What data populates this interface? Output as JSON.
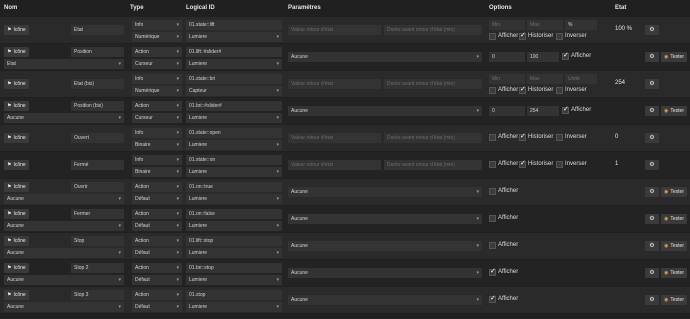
{
  "headers": {
    "nom": "Nom",
    "type": "Type",
    "logical_id": "Logical ID",
    "parametres": "Paramètres",
    "options": "Options",
    "etat": "Etat"
  },
  "labels": {
    "icone": "Icône",
    "tester": "Tester",
    "afficher": "Afficher",
    "historiser": "Historiser",
    "inverser": "Inverser",
    "valeur_retour_etat": "Valeur retour d'état",
    "duree_retour_etat": "Durée avant retour d'état (min)",
    "min": "Min",
    "max": "Max",
    "unite": "Unité",
    "percent": "%"
  },
  "rows": [
    {
      "name": "Etat",
      "type1": "Info",
      "type2": "Numérique",
      "lid": "01.state::lift",
      "lid2": "Lumiere",
      "params": "info",
      "unit": "%",
      "min_ph": "Min",
      "max_ph": "Max",
      "afficher": false,
      "historiser": true,
      "inverser": false,
      "etat": "100 %",
      "tester": false
    },
    {
      "name": "Position",
      "sub": "Etat",
      "type1": "Action",
      "type2": "Curseur",
      "lid": "01.lift::#slider#",
      "lid2": "Lumiere",
      "params": "select",
      "select_val": "Aucune",
      "min": "0",
      "max": "100",
      "afficher": true,
      "tester": true
    },
    {
      "name": "Etat (bis)",
      "type1": "Info",
      "type2": "Numérique",
      "lid": "01.state::bri",
      "lid2": "Capteur",
      "params": "info",
      "unit": "Unité",
      "min_ph": "Min",
      "max_ph": "Max",
      "afficher": false,
      "historiser": true,
      "inverser": false,
      "etat": "254",
      "tester": false
    },
    {
      "name": "Position (bis)",
      "sub": "Aucune",
      "type1": "Action",
      "type2": "Curseur",
      "lid": "01.bri::#slider#",
      "lid2": "Lumiere",
      "params": "select",
      "select_val": "Aucune",
      "min": "0",
      "max": "254",
      "afficher": true,
      "tester": true
    },
    {
      "name": "Ouvert",
      "type1": "Info",
      "type2": "Binaire",
      "lid": "01.state::open",
      "lid2": "Lumiere",
      "params": "info2",
      "afficher": false,
      "historiser": true,
      "inverser": false,
      "etat": "0",
      "tester": false
    },
    {
      "name": "Fermé",
      "type1": "Info",
      "type2": "Binaire",
      "lid": "01.state::on",
      "lid2": "Lumiere",
      "params": "info2",
      "afficher": false,
      "historiser": true,
      "inverser": false,
      "etat": "1",
      "tester": false
    },
    {
      "name": "Ouvrir",
      "sub": "Aucune",
      "type1": "Action",
      "type2": "Défaut",
      "lid": "01.on::true",
      "lid2": "Lumiere",
      "params": "select",
      "select_val": "Aucune",
      "afficher": false,
      "tester": true
    },
    {
      "name": "Fermer",
      "sub": "Aucune",
      "type1": "Action",
      "type2": "Défaut",
      "lid": "01.on::false",
      "lid2": "Lumiere",
      "params": "select",
      "select_val": "Aucune",
      "afficher": false,
      "tester": true
    },
    {
      "name": "Stop",
      "sub": "Aucune",
      "type1": "Action",
      "type2": "Défaut",
      "lid": "01.lift::stop",
      "lid2": "Lumiere",
      "params": "select",
      "select_val": "Aucune",
      "afficher": false,
      "tester": true
    },
    {
      "name": "Stop 2",
      "sub": "Aucune",
      "type1": "Action",
      "type2": "Défaut",
      "lid": "01.bri::stop",
      "lid2": "Lumiere",
      "params": "select",
      "select_val": "Aucune",
      "afficher": true,
      "tester": true
    },
    {
      "name": "Stop 3",
      "sub": "Aucune",
      "type1": "Action",
      "type2": "Défaut",
      "lid": "01.stop",
      "lid2": "Lumiere",
      "params": "select",
      "select_val": "Aucune",
      "afficher": true,
      "tester": true
    }
  ]
}
